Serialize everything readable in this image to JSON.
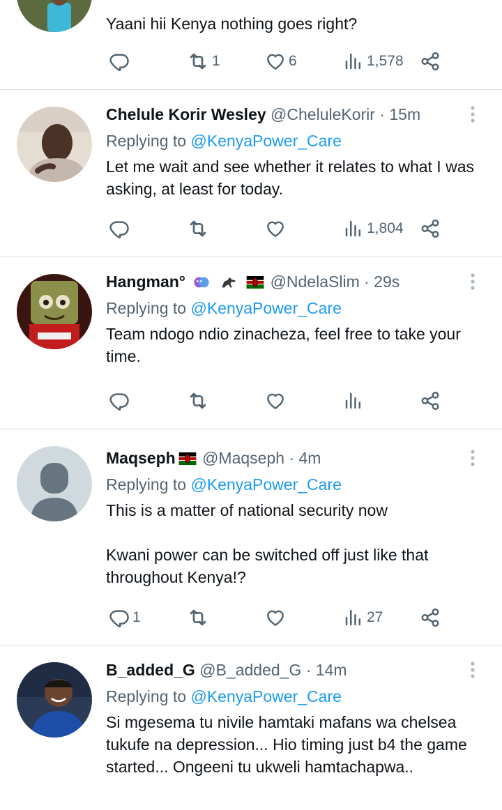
{
  "tweets": [
    {
      "name": "",
      "handle": "",
      "time": "",
      "replying_prefix": "",
      "replying_to": "",
      "text": "Yaani hii Kenya nothing goes right?",
      "stats": {
        "replies": "",
        "retweets": "1",
        "likes": "6",
        "views": "1,578"
      }
    },
    {
      "name": "Chelule Korir Wesley",
      "handle": "@CheluleKorir",
      "time": "· 15m",
      "replying_prefix": "Replying to ",
      "replying_to": "@KenyaPower_Care",
      "text": "Let me wait and see whether it relates to what I was asking, at least for today.",
      "stats": {
        "replies": "",
        "retweets": "",
        "likes": "",
        "views": "1,804"
      }
    },
    {
      "name": "Hangman°",
      "handle": "@NdelaSlim",
      "time": "· 29s",
      "replying_prefix": "Replying to ",
      "replying_to": "@KenyaPower_Care",
      "text": "Team ndogo ndio zinacheza, feel free to take your time.",
      "stats": {
        "replies": "",
        "retweets": "",
        "likes": "",
        "views": ""
      }
    },
    {
      "name": "Maqseph",
      "handle": "@Maqseph",
      "time": "· 4m",
      "replying_prefix": "Replying to ",
      "replying_to": "@KenyaPower_Care",
      "text": "This is a matter of national security now\n\nKwani power can be switched off just like that throughout Kenya!?",
      "stats": {
        "replies": "1",
        "retweets": "",
        "likes": "",
        "views": "27"
      }
    },
    {
      "name": "B_added_G",
      "handle": "@B_added_G",
      "time": "· 14m",
      "replying_prefix": "Replying to ",
      "replying_to": "@KenyaPower_Care",
      "text": "Si mgesema tu nivile hamtaki mafans wa chelsea tukufe na depression... Hio timing just b4 the game started... Ongeeni tu ukweli hamtachapwa..",
      "stats": {
        "replies": "",
        "retweets": "",
        "likes": "",
        "views": ""
      }
    }
  ],
  "icons": {
    "reply": "reply-icon",
    "retweet": "retweet-icon",
    "like": "heart-icon",
    "views": "views-icon",
    "share": "share-icon",
    "more": "more-icon"
  },
  "colors": {
    "link": "#1d9bf0",
    "secondary": "#536471",
    "text": "#0f1419",
    "divider": "#d8dde1"
  }
}
